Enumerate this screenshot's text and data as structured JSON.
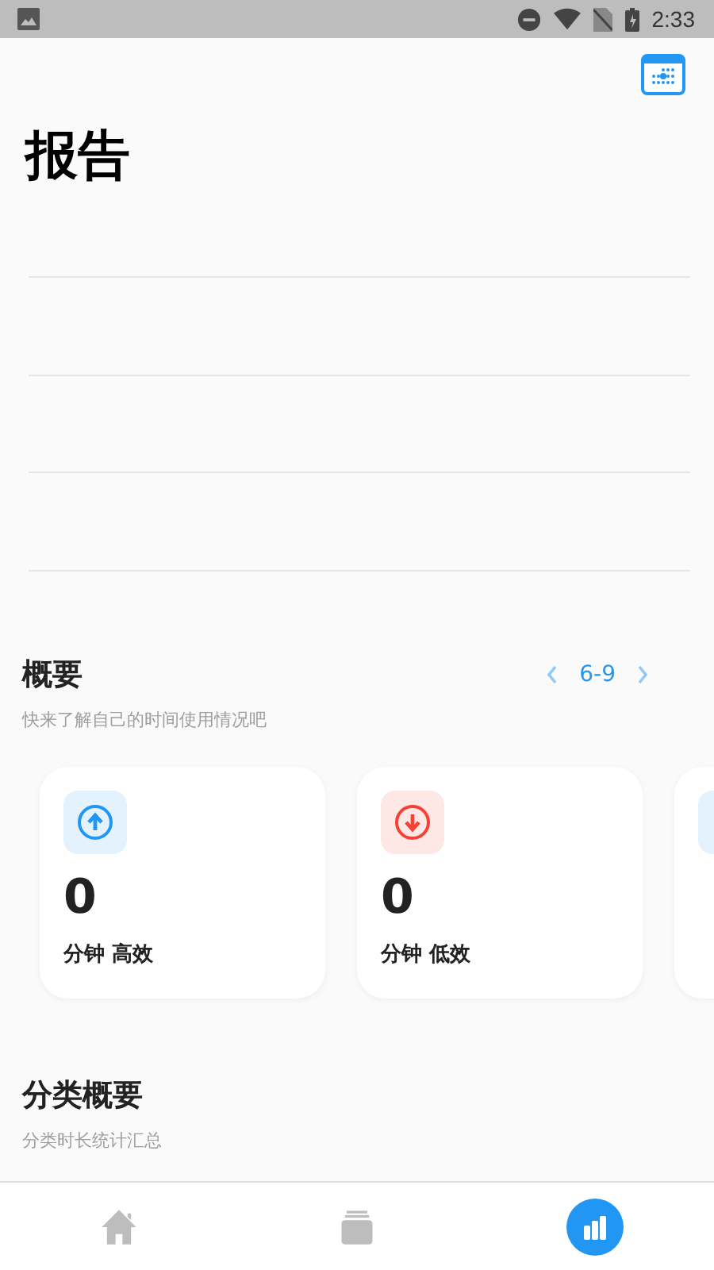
{
  "status_bar": {
    "time": "2:33"
  },
  "header": {
    "title": "报告"
  },
  "overview": {
    "title": "概要",
    "subtitle": "快来了解自己的时间使用情况吧",
    "range": "6-9",
    "cards": [
      {
        "kind": "up",
        "value": "0",
        "label": "分钟 高效"
      },
      {
        "kind": "down",
        "value": "0",
        "label": "分钟 低效"
      },
      {
        "kind": "up"
      }
    ]
  },
  "category": {
    "title": "分类概要",
    "subtitle": "分类时长统计汇总"
  },
  "nav": [
    {
      "kind": "home",
      "selected": false
    },
    {
      "kind": "cards",
      "selected": false
    },
    {
      "kind": "chart",
      "selected": true
    }
  ]
}
